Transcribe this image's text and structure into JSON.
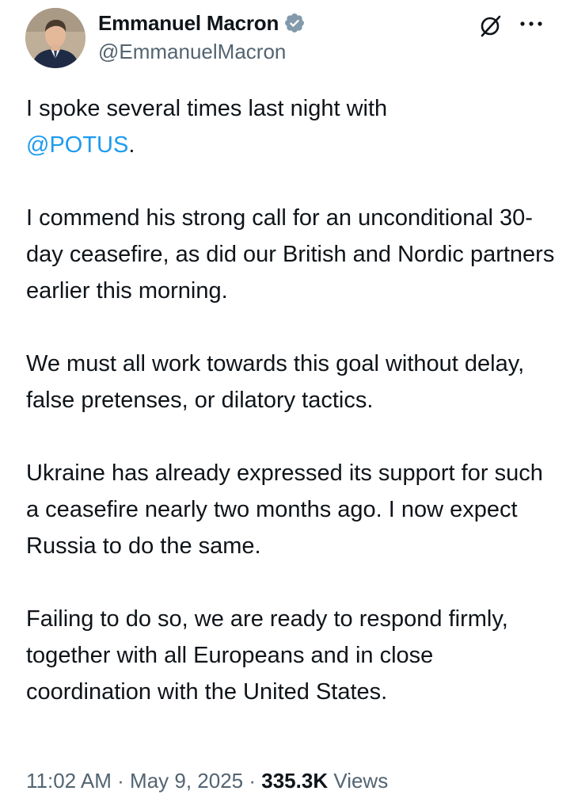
{
  "author": {
    "display_name": "Emmanuel Macron",
    "handle": "@EmmanuelMacron",
    "verified": true,
    "avatar_icon": "profile-photo"
  },
  "actions": {
    "grok_icon": "grok-icon",
    "more_icon": "more-dots-icon"
  },
  "tweet": {
    "p1_text": "I spoke several times last night with ",
    "p1_mention": "@POTUS",
    "p1_end": ".",
    "p2": "I commend his strong call for an unconditional 30-day ceasefire, as did our British and Nordic partners earlier this morning.",
    "p3": "We must all work towards this goal without delay, false pretenses, or dilatory tactics.",
    "p4": "Ukraine has already expressed its support for such a ceasefire nearly two months ago. I now expect Russia to do the same.",
    "p5": "Failing to do so, we are ready to respond firmly, together with all Europeans and in close coordination with the United States."
  },
  "meta": {
    "time": "11:02 AM",
    "sep1": " · ",
    "date": "May 9, 2025",
    "sep2": " · ",
    "views_count": "335.3K",
    "views_label": " Views"
  },
  "colors": {
    "link": "#1d9bf0",
    "secondary_text": "#536471",
    "primary_text": "#0f1419",
    "verified_badge": "#829aab"
  }
}
